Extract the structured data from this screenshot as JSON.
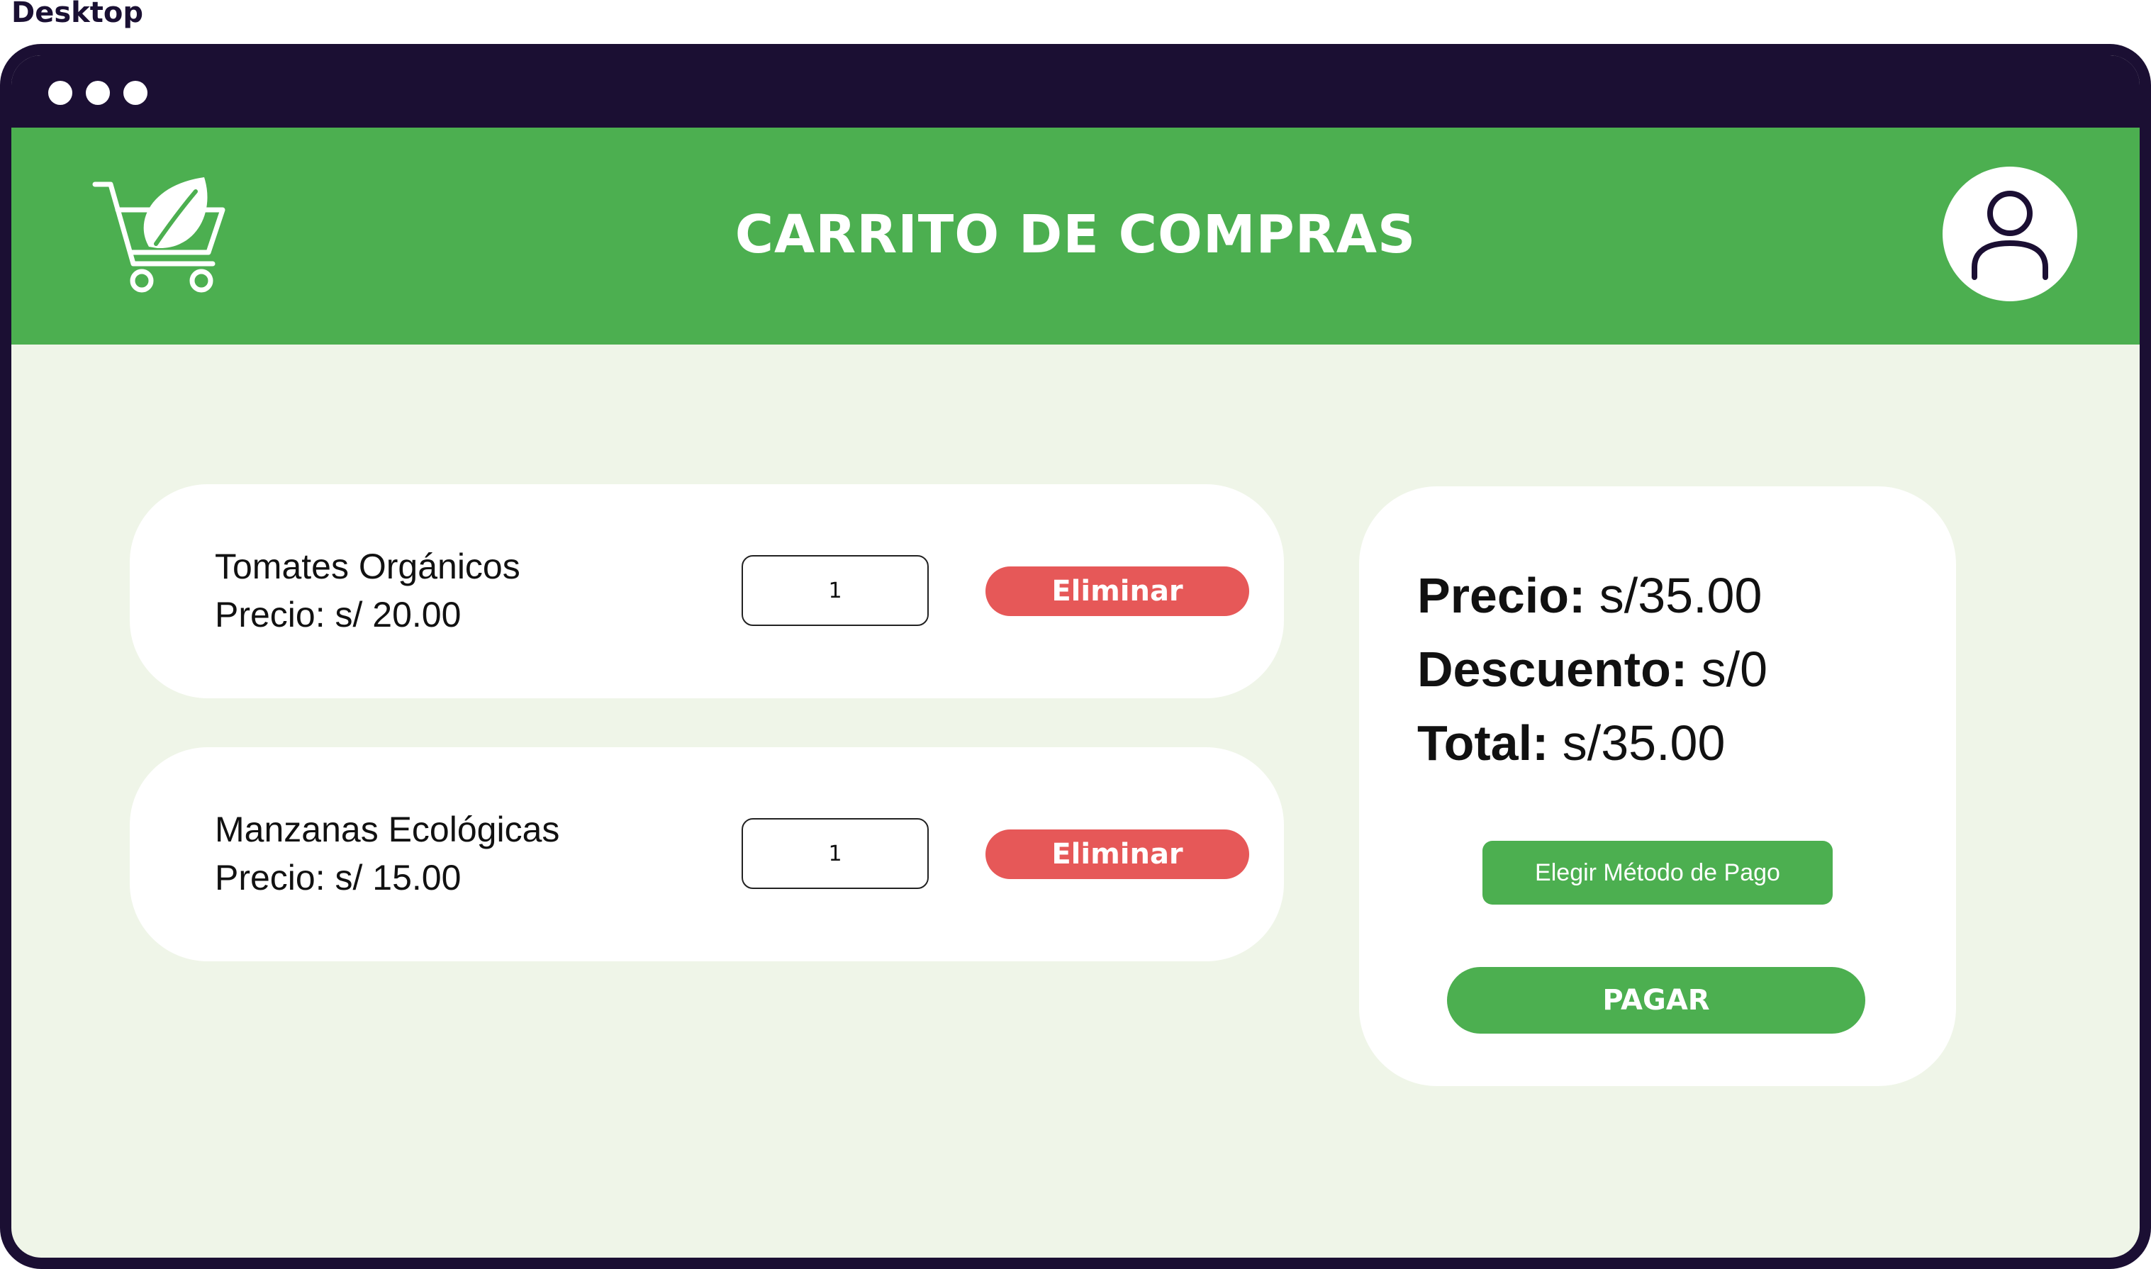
{
  "frame_label": "Desktop",
  "header": {
    "title": "CARRITO DE COMPRAS",
    "logo_icon": "cart-leaf-icon",
    "avatar_icon": "user-icon"
  },
  "cart": {
    "items": [
      {
        "name": "Tomates Orgánicos",
        "price": "Precio: s/ 20.00",
        "quantity": "1",
        "remove_label": "Eliminar"
      },
      {
        "name": "Manzanas Ecológicas",
        "price": "Precio: s/ 15.00",
        "quantity": "1",
        "remove_label": "Eliminar"
      }
    ]
  },
  "summary": {
    "price_label": "Precio:",
    "price_value": "s/35.00",
    "discount_label": "Descuento:",
    "discount_value": "s/0",
    "total_label": "Total:",
    "total_value": "s/35.00",
    "payment_method_label": "Elegir Método de Pago",
    "pay_label": "PAGAR"
  },
  "colors": {
    "window_frame": "#1b0f33",
    "header_green": "#4caf50",
    "page_background": "#eff5e8",
    "remove_red": "#e65858",
    "card_white": "#ffffff"
  }
}
